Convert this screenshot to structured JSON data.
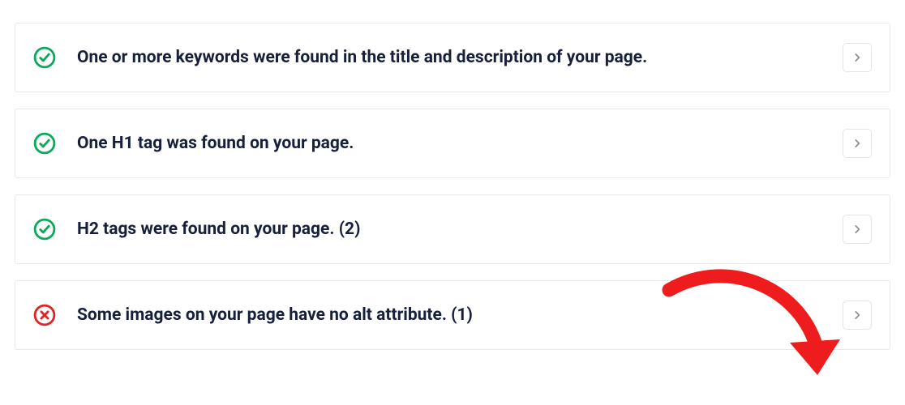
{
  "colors": {
    "success": "#0aaa5a",
    "error": "#e02424",
    "text": "#17203a",
    "chevron": "#8a8f99",
    "annotation": "#ee1c1c"
  },
  "items": [
    {
      "status": "success",
      "text": "One or more keywords were found in the title and description of your page."
    },
    {
      "status": "success",
      "text": "One H1 tag was found on your page."
    },
    {
      "status": "success",
      "text": "H2 tags were found on your page. (2)"
    },
    {
      "status": "error",
      "text": "Some images on your page have no alt attribute. (1)"
    }
  ]
}
